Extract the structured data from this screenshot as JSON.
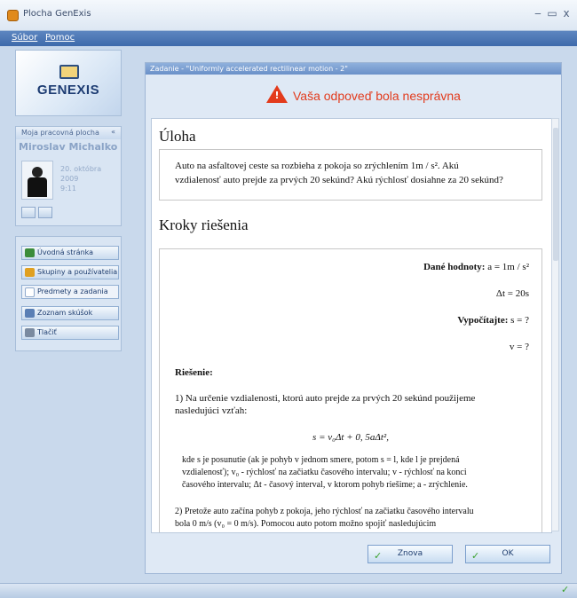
{
  "window": {
    "title": "Plocha GenExis",
    "minimize": "‒",
    "maximize": "▭",
    "close": "x"
  },
  "menu": {
    "file": "Súbor",
    "help": "Pomoc"
  },
  "logo": {
    "text": "GENEXIS"
  },
  "user_panel": {
    "header": "Moja pracovná plocha",
    "collapse": "«",
    "name": "Miroslav Michalko",
    "date": "20. októbra 2009",
    "time": "9:11"
  },
  "nav": {
    "items": [
      {
        "label": "Úvodná stránka",
        "icon": "home-icon",
        "color": "#3b8c3b"
      },
      {
        "label": "Skupiny a používatelia",
        "icon": "users-icon",
        "color": "#e0a020"
      },
      {
        "label": "Predmety a zadania",
        "icon": "document-icon",
        "color": "#ffffff"
      },
      {
        "label": "Zoznam skúšok",
        "icon": "exam-list-icon",
        "color": "#5a7fb5"
      },
      {
        "label": "Tlačiť",
        "icon": "printer-icon",
        "color": "#7a8aa0"
      }
    ]
  },
  "dialog": {
    "title": "Zadanie - \"Uniformly accelerated rectilinear motion - 2\"",
    "alert": "Vaša odpoveď bola nesprávna",
    "task_heading": "Úloha",
    "task_line1": "Auto na asfaltovej ceste sa rozbieha z pokoja so zrýchlením 1m / s². Akú",
    "task_line2": "vzdialenosť auto prejde za prvých 20 sekúnd? Akú rýchlosť dosiahne za 20 sekúnd?",
    "steps_heading": "Kroky riešenia",
    "given_label": "Dané hodnoty:",
    "given_value": " a = 1m / s²",
    "dt_value": "Δt = 20s",
    "compute_label": "Vypočítajte:",
    "compute_value": " s = ?",
    "v_value": "v = ?",
    "solution_label": "Riešenie:",
    "step1_line1": "1) Na určenie vzdialenosti, ktorú auto prejde za prvých 20 sekúnd použijeme",
    "step1_line2": "nasledujúci vzťah:",
    "formula": "s = v₀Δt + 0, 5aΔt²,",
    "expl_line1": "kde s je posunutie (ak je pohyb v jednom smere, potom s = l, kde l je prejdená",
    "expl_line2": "vzdialenosť); v₀ - rýchlosť na začiatku časového intervalu; v - rýchlosť na konci",
    "expl_line3": "časového intervalu; Δt - časový interval, v ktorom pohyb riešime; a - zrýchlenie.",
    "step2_line1": "2) Pretože auto začína pohyb z pokoja, jeho rýchlosť na začiatku časového intervalu",
    "step2_line2": "bola 0 m/s (v₀ = 0 m/s). Pomocou auto potom možno spojiť nasledujúcim",
    "buttons": {
      "retry": "Znova",
      "ok": "OK"
    }
  }
}
